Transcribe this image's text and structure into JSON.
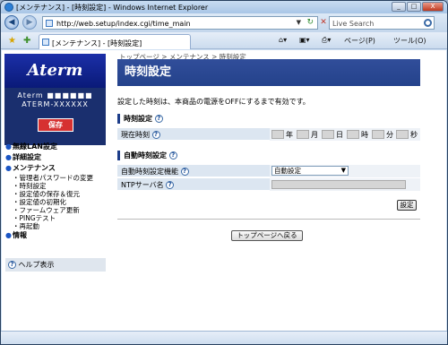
{
  "window": {
    "title": "[メンテナンス] - [時刻設定] - Windows Internet Explorer",
    "minimize": "_",
    "maximize": "□",
    "close": "X"
  },
  "address": {
    "url": "http://web.setup/index.cgi/time_main",
    "search_placeholder": "Live Search"
  },
  "tab": {
    "label": "[メンテナンス] - [時刻設定]"
  },
  "toolbar": {
    "page": "ページ(P)",
    "tools": "ツール(O)"
  },
  "sidebar": {
    "logo": "Aterm",
    "device_name": "Aterm ■■■■■■",
    "device_model": "ATERM-XXXXXX",
    "save_label": "保存",
    "nav": [
      {
        "label": "無線LAN設定"
      },
      {
        "label": "詳細設定"
      },
      {
        "label": "メンテナンス",
        "items": [
          "管理者パスワードの変更",
          "時刻設定",
          "設定値の保存＆復元",
          "設定値の初期化",
          "ファームウェア更新",
          "PINGテスト",
          "再起動"
        ]
      },
      {
        "label": "情報"
      }
    ],
    "help_label": "ヘルプ表示"
  },
  "main": {
    "breadcrumb": "トップページ > メンテナンス > 時刻設定",
    "title": "時刻設定",
    "description": "設定した時刻は、本商品の電源をOFFにするまで有効です。",
    "section1": "時刻設定",
    "current_time_label": "現在時刻",
    "time_units": [
      "年",
      "月",
      "日",
      "時",
      "分",
      "秒"
    ],
    "section2": "自動時刻設定",
    "auto_label": "自動時刻設定機能",
    "auto_value": "自動設定",
    "ntp_label": "NTPサーバ名",
    "set_button": "設定",
    "back_button": "トップページへ戻る"
  }
}
